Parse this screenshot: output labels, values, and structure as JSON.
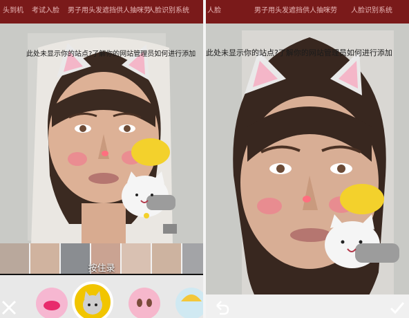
{
  "left": {
    "red_bar_texts": [
      "头到机",
      "考试入脸",
      "男子用头发遮挡供人抽咪劳",
      "人脸识别系统"
    ],
    "monitor_caption": "此处未显示你的站点?了解你的网站管理员如何进行添加",
    "record_hint": "按住录"
  },
  "right": {
    "red_bar_texts": [
      "人脸",
      "男子用头发遮挡供人抽咪劳",
      "人脸识别系统"
    ],
    "monitor_caption": "此处未显示你的站点?了解你的网站管理员如何进行添加"
  },
  "colors": {
    "accent": "#f1c500",
    "sticker_pink": "#f3b8d0",
    "bar_red": "#7a1a1a"
  }
}
